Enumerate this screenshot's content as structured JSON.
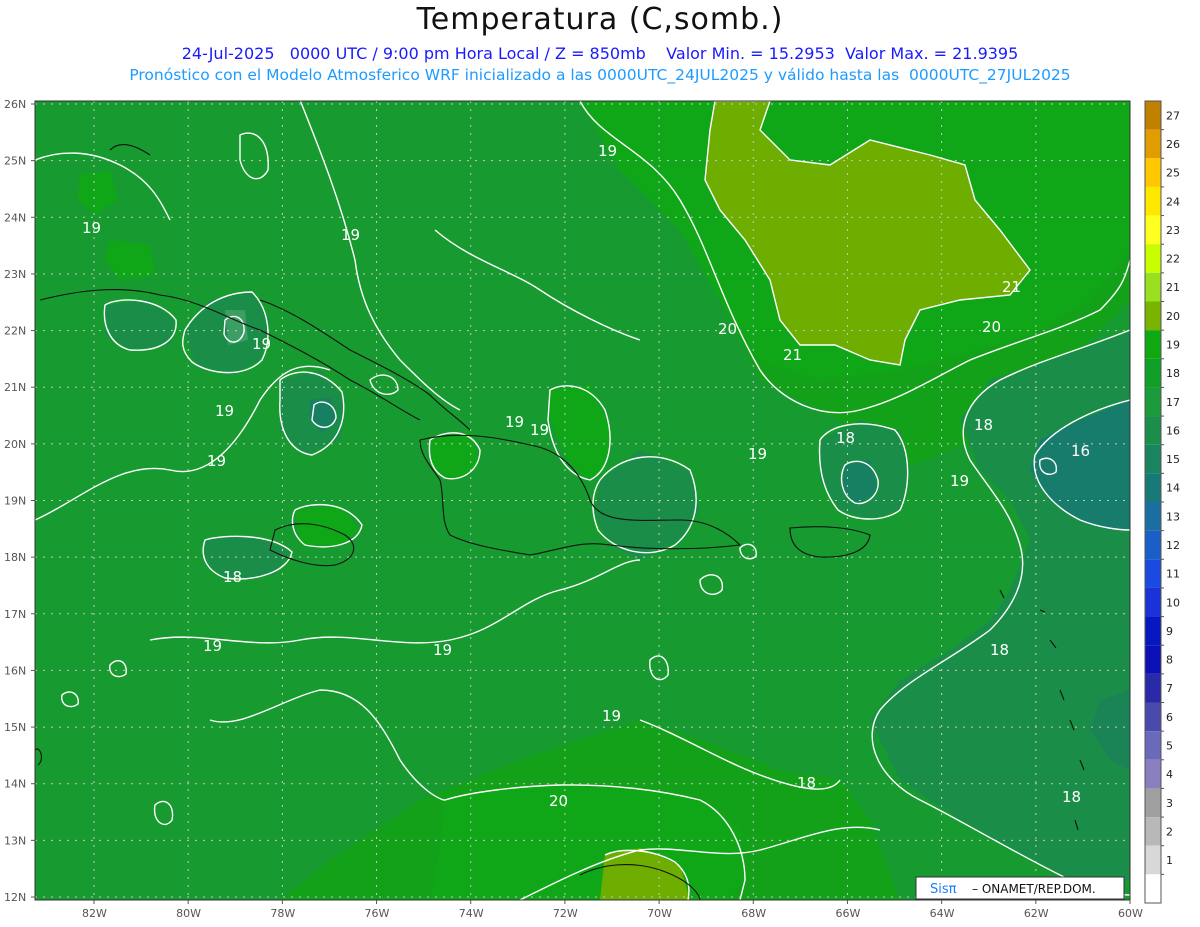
{
  "title": "Temperatura (C,somb.)",
  "subtitle1": "24-Jul-2025   0000 UTC / 9:00 pm Hora Local / Z = 850mb    Valor Min. = 15.2953  Valor Max. = 21.9395",
  "subtitle2": "Pronóstico con el Modelo Atmosferico WRF inicializado a las 0000UTC_24JUL2025 y válido hasta las  0000UTC_27JUL2025",
  "credit": {
    "brand": "Sisπ",
    "text": "– ONAMET/REP.DOM."
  },
  "lat_labels": [
    "26N",
    "25N",
    "24N",
    "23N",
    "22N",
    "21N",
    "20N",
    "19N",
    "18N",
    "17N",
    "16N",
    "15N",
    "14N",
    "13N",
    "12N"
  ],
  "lon_labels": [
    "82W",
    "80W",
    "78W",
    "76W",
    "74W",
    "72W",
    "70W",
    "68W",
    "66W",
    "64W",
    "62W",
    "60W"
  ],
  "colorbar": {
    "levels": [
      "27",
      "26",
      "25",
      "24",
      "23",
      "22",
      "21",
      "20",
      "19",
      "18",
      "17",
      "16",
      "15",
      "14",
      "13",
      "12",
      "11",
      "10",
      "9",
      "8",
      "7",
      "6",
      "5",
      "4",
      "3",
      "2",
      "1"
    ],
    "colors": [
      "#c08000",
      "#e09c00",
      "#ffc800",
      "#ffe800",
      "#ffff20",
      "#c8ff00",
      "#98e020",
      "#78b400",
      "#10a810",
      "#10a028",
      "#1a9a3a",
      "#1a8e4a",
      "#1a8460",
      "#187a78",
      "#1a6ea0",
      "#1a5ec8",
      "#1a4ae0",
      "#1a32d8",
      "#0818c0",
      "#0a10b4",
      "#2a2aa8",
      "#4a4aac",
      "#6a6aba",
      "#8a80c0",
      "#a0a0a0",
      "#b8b8b8",
      "#d8d8d8",
      "#ffffff"
    ]
  },
  "contour_labels": [
    "19",
    "19",
    "19",
    "19",
    "19",
    "19",
    "19",
    "19",
    "19",
    "19",
    "19",
    "19",
    "19",
    "20",
    "20",
    "20",
    "21",
    "21",
    "18",
    "18",
    "18",
    "18",
    "18",
    "18",
    "16"
  ],
  "fields": {
    "min": 15.2953,
    "max": 21.9395,
    "units": "C",
    "level": "850mb"
  }
}
